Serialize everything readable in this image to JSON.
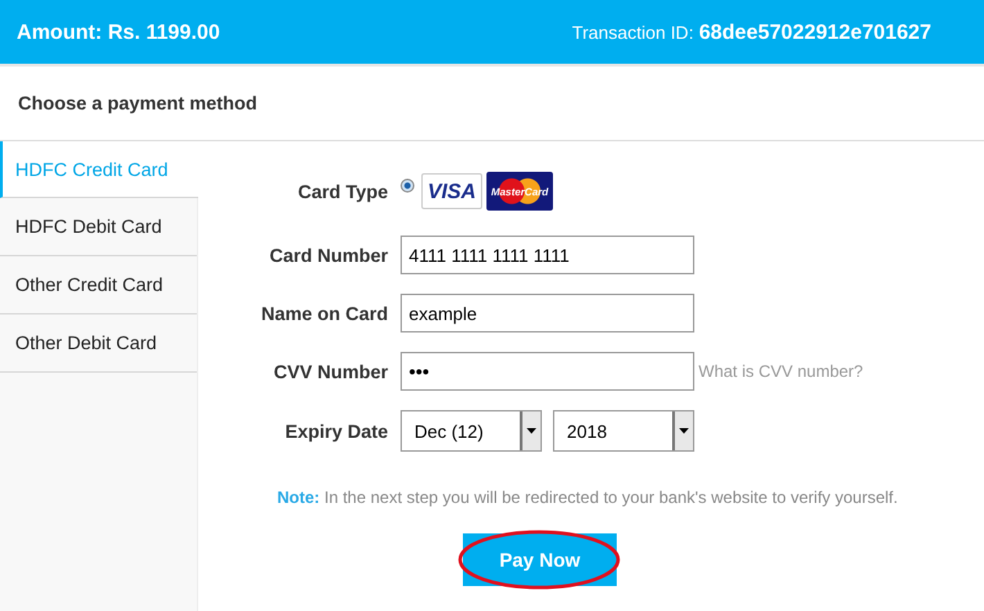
{
  "header": {
    "amount_label": "Amount:",
    "amount": "Rs. 1199.00",
    "transaction_label": "Transaction ID:",
    "transaction_id": "68dee57022912e701627"
  },
  "section_title": "Choose a payment method",
  "methods": [
    {
      "label": "HDFC Credit Card",
      "selected": true
    },
    {
      "label": "HDFC Debit Card",
      "selected": false
    },
    {
      "label": "Other Credit Card",
      "selected": false
    },
    {
      "label": "Other Debit Card",
      "selected": false
    }
  ],
  "form": {
    "card_type": {
      "label": "Card Type",
      "selected": true,
      "brands": [
        {
          "kind": "visa",
          "text": "VISA"
        },
        {
          "kind": "mastercard",
          "text": "MasterCard"
        }
      ]
    },
    "fields": [
      {
        "kind": "text",
        "label": "Card Number",
        "value": "4111 1111 1111 1111"
      },
      {
        "kind": "text",
        "label": "Name on Card",
        "value": "example"
      },
      {
        "kind": "password",
        "label": "CVV Number",
        "value": "•••",
        "help": "What is CVV number?"
      },
      {
        "kind": "selects",
        "label": "Expiry Date",
        "options": [
          "Dec (12)",
          "2018"
        ]
      }
    ]
  },
  "note": {
    "label": "Note:",
    "text": "In the next step you will be redirected to your bank's website to verify yourself."
  },
  "pay_button": {
    "label": "Pay Now",
    "circled": true
  }
}
